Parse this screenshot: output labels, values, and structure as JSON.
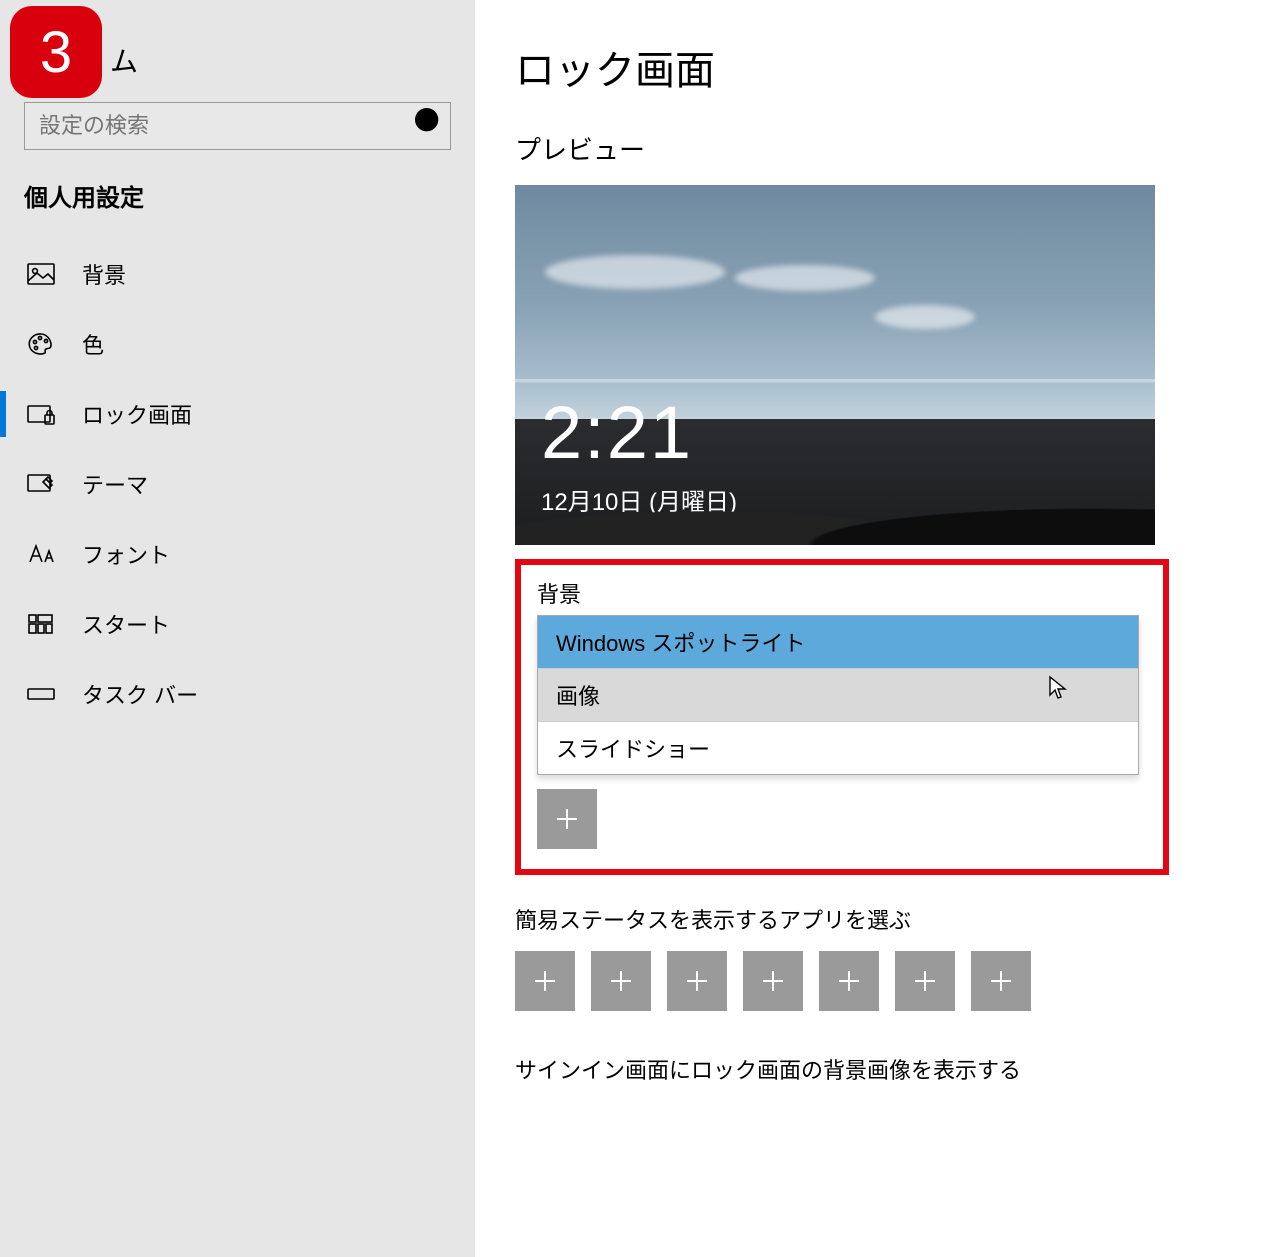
{
  "step_badge": "3",
  "sidebar": {
    "home_suffix": "ム",
    "search_placeholder": "設定の検索",
    "section": "個人用設定",
    "items": [
      {
        "label": "背景",
        "icon": "picture-icon",
        "active": false
      },
      {
        "label": "色",
        "icon": "palette-icon",
        "active": false
      },
      {
        "label": "ロック画面",
        "icon": "lockscreen-icon",
        "active": true
      },
      {
        "label": "テーマ",
        "icon": "theme-icon",
        "active": false
      },
      {
        "label": "フォント",
        "icon": "font-icon",
        "active": false
      },
      {
        "label": "スタート",
        "icon": "start-icon",
        "active": false
      },
      {
        "label": "タスク バー",
        "icon": "taskbar-icon",
        "active": false
      }
    ]
  },
  "main": {
    "title": "ロック画面",
    "preview_label": "プレビュー",
    "preview_time": "2:21",
    "preview_date": "12月10日 (月曜日)",
    "background_label": "背景",
    "dropdown": {
      "options": [
        {
          "label": "Windows スポットライト",
          "state": "selected"
        },
        {
          "label": "画像",
          "state": "hover"
        },
        {
          "label": "スライドショー",
          "state": ""
        }
      ]
    },
    "quick_status_label": "簡易ステータスを表示するアプリを選ぶ",
    "quick_status_slots": 7,
    "signin_label": "サインイン画面にロック画面の背景画像を表示する"
  }
}
